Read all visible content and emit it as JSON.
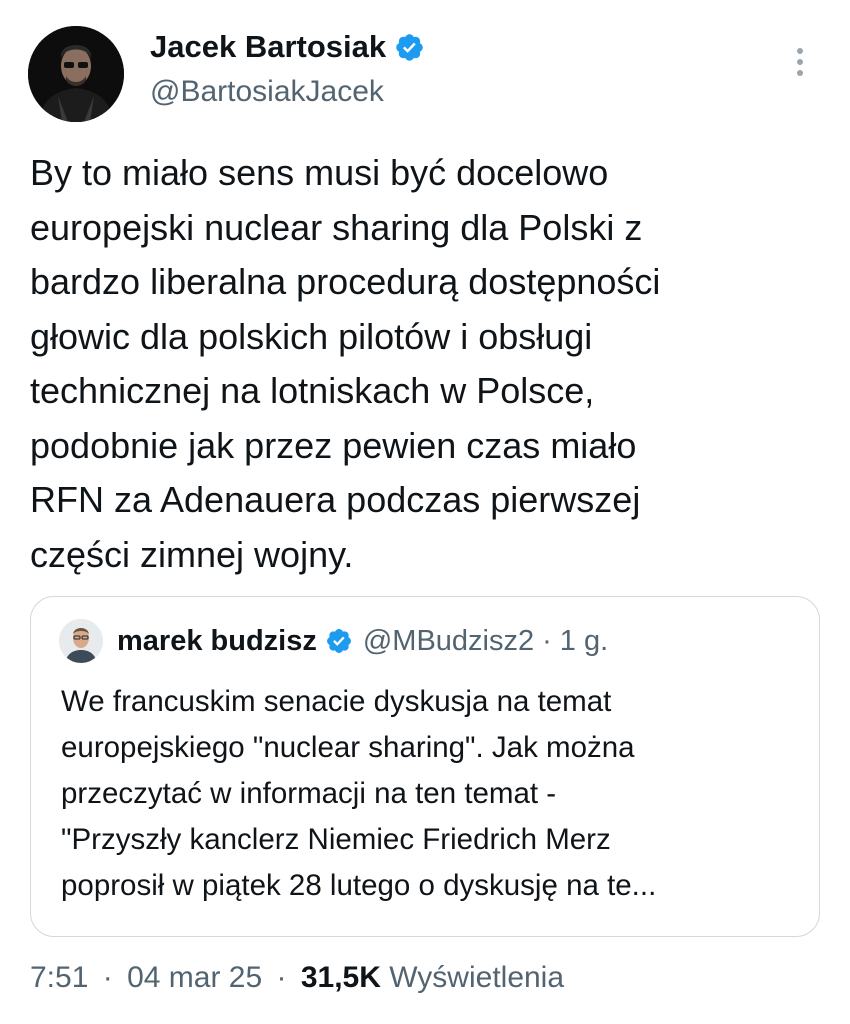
{
  "author": {
    "name": "Jacek Bartosiak",
    "handle": "@BartosiakJacek",
    "verified_icon": "verified-badge-icon"
  },
  "more_icon": "more-vertical-icon",
  "tweet": {
    "lines": [
      "By to miało sens musi być docelowo",
      "europejski nuclear sharing dla Polski z",
      "bardzo liberalna procedurą dostępności",
      "głowic dla polskich pilotów i obsługi",
      "technicznej na lotniskach w Polsce,",
      "podobnie jak przez pewien czas miało",
      "RFN za Adenauera podczas pierwszej",
      "części zimnej wojny."
    ]
  },
  "quote": {
    "name": "marek budzisz",
    "handle": "@MBudzisz2",
    "separator": "·",
    "age": "1 g.",
    "lines": [
      "We francuskim senacie dyskusja na temat",
      "europejskiego \"nuclear sharing\". Jak można",
      "przeczytać w informacji na ten temat -",
      "\"Przyszły kanclerz Niemiec Friedrich Merz",
      "poprosił w piątek 28 lutego o dyskusję na te..."
    ]
  },
  "footer": {
    "time": "7:51",
    "sep1": "·",
    "date": "04 mar 25",
    "sep2": "·",
    "views_count": "31,5K",
    "views_label": "Wyświetlenia"
  },
  "colors": {
    "text": "#0f1419",
    "secondary": "#536471",
    "verified": "#1d9bf0",
    "border": "#cfd9de"
  }
}
